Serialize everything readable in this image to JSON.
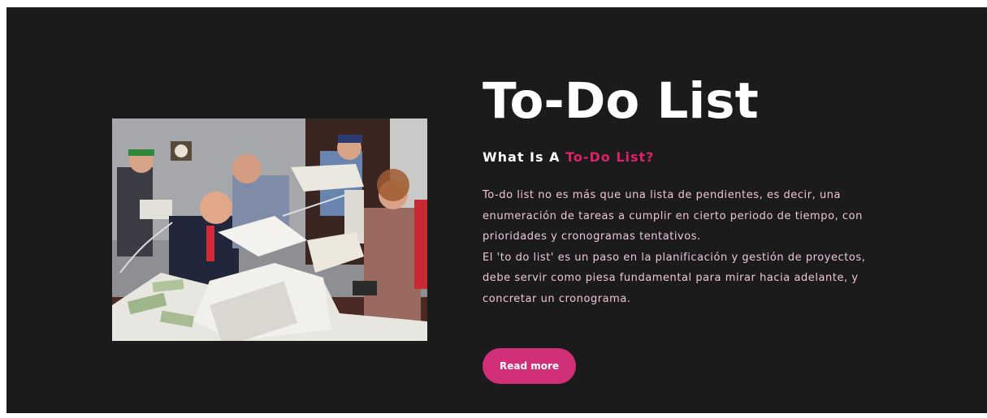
{
  "section": {
    "title": "To-Do List",
    "subtitle_prefix": "What Is A ",
    "subtitle_accent": "To-Do List?",
    "paragraphs": [
      "To-do list no es más que una lista de pendientes, es decir, una enumeración de tareas a cumplir en cierto periodo de tiempo, con prioridades y cronogramas tentativos.",
      "El 'to do list' es un paso en la planificación y gestión de proyectos, debe servir como piesa fundamental para mirar hacia adelante, y concretar un cronograma."
    ],
    "button_label": "Read more"
  },
  "colors": {
    "background": "#1c1b1c",
    "title": "#ffffff",
    "accent": "#e0206a",
    "body_text": "#ecc5da",
    "button": "#d12f77"
  }
}
